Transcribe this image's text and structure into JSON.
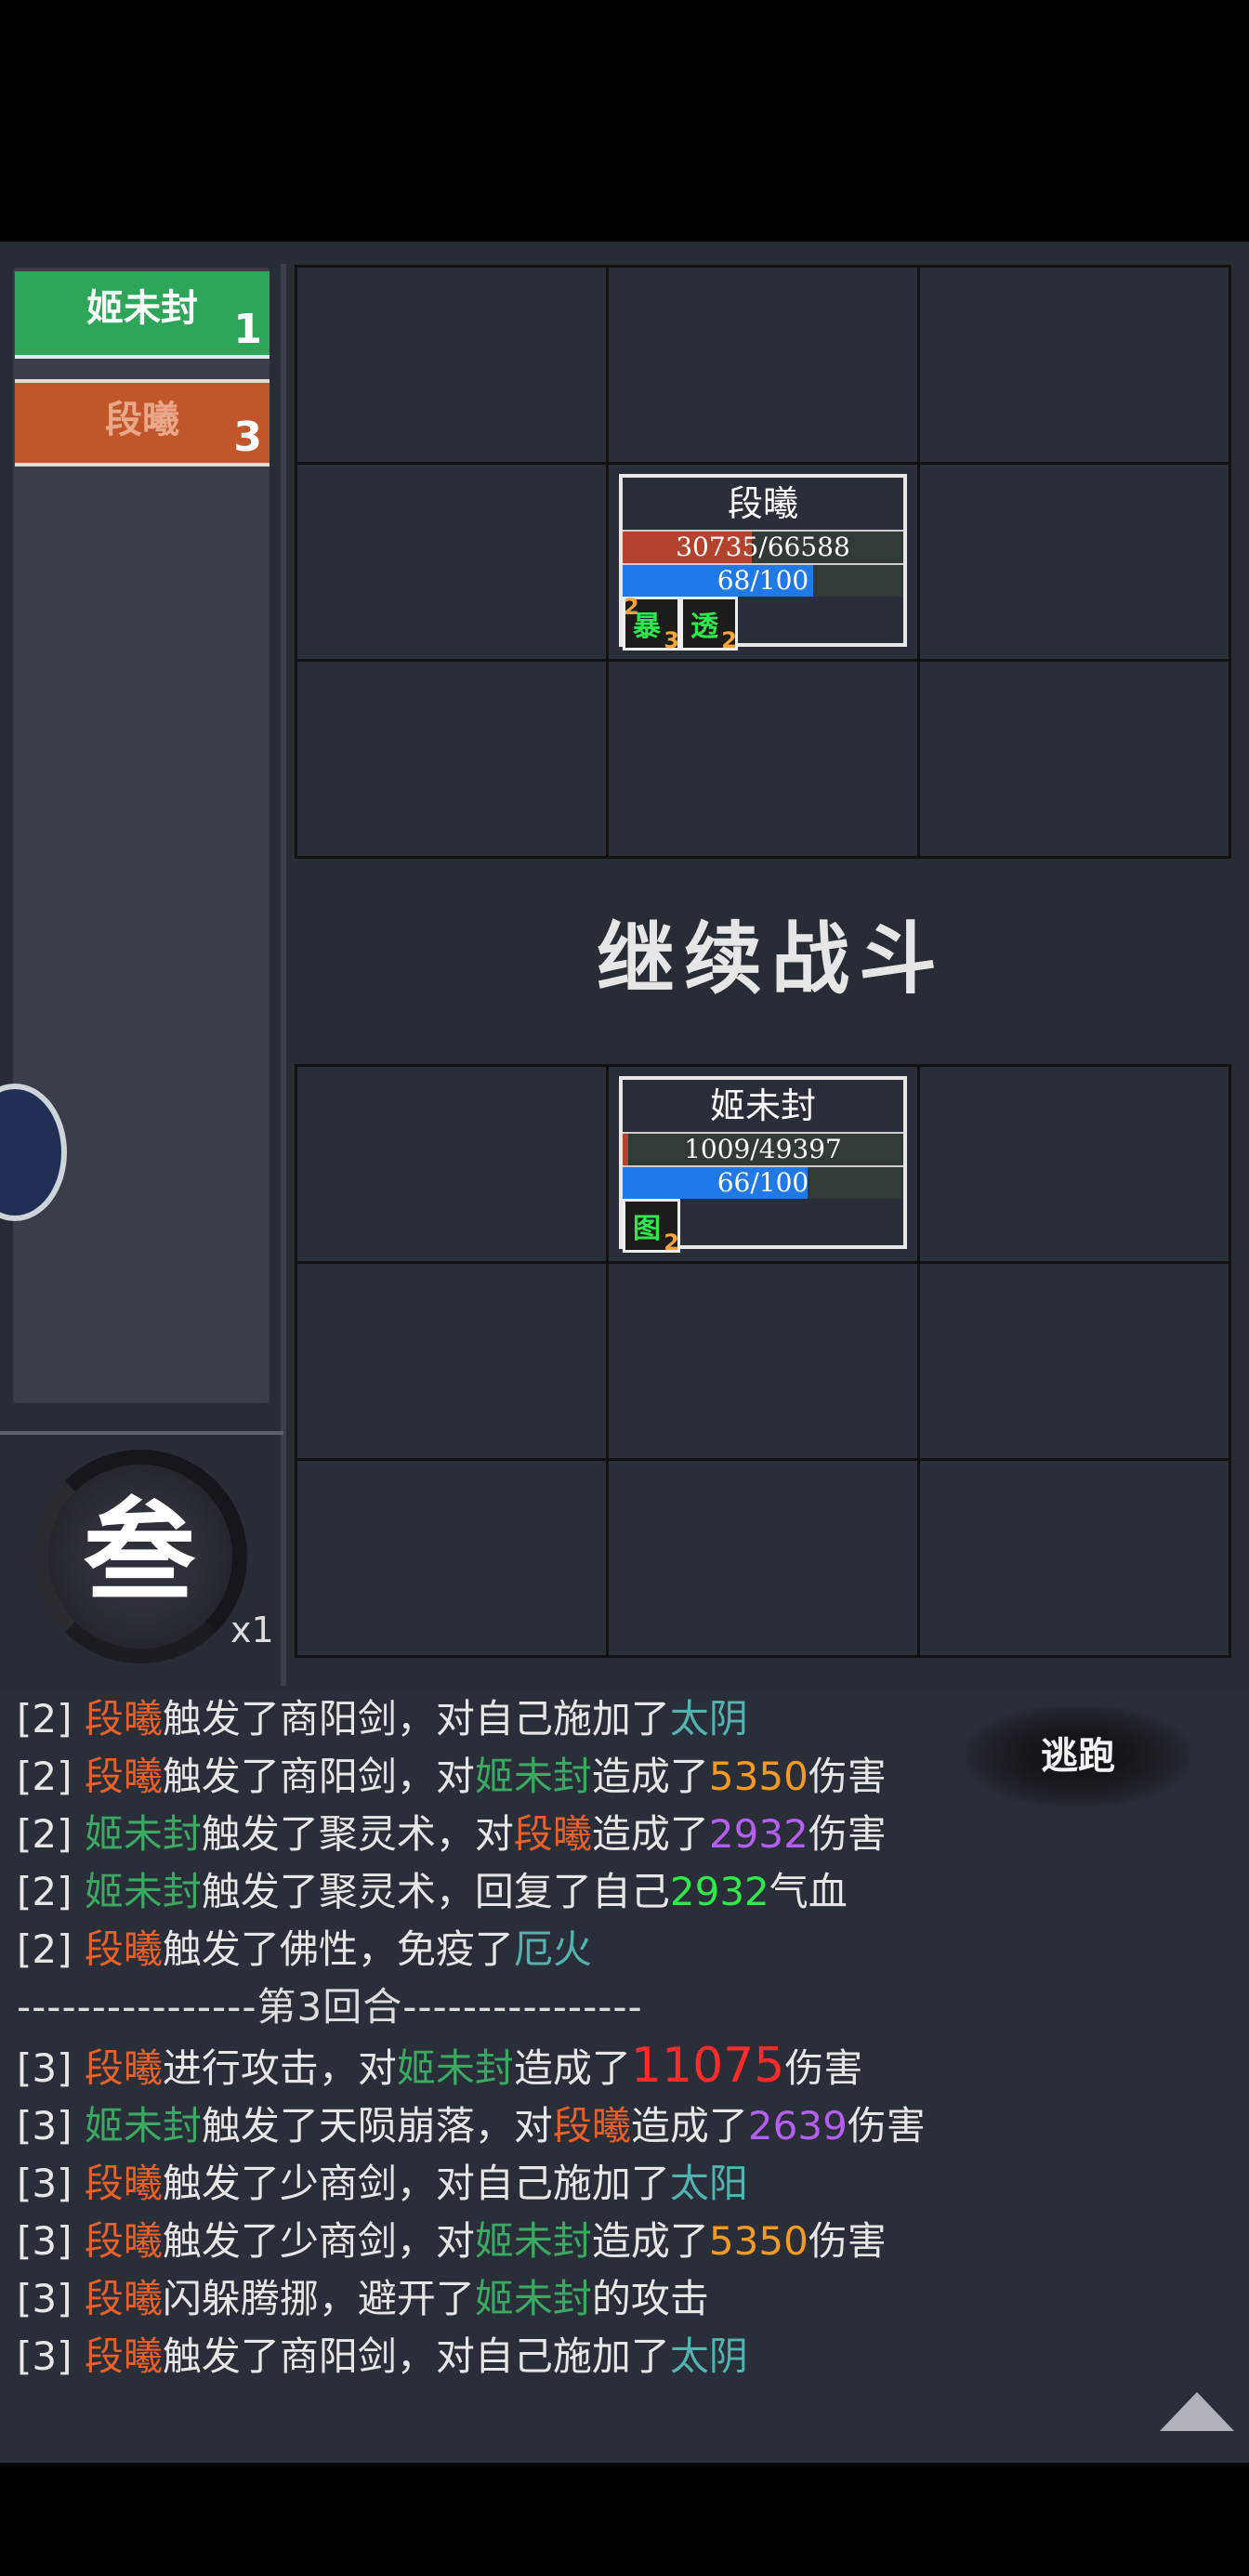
{
  "team_list": [
    {
      "name": "姬未封",
      "count": "1"
    },
    {
      "name": "段曦",
      "count": "3"
    }
  ],
  "enemy_unit": {
    "name": "段曦",
    "hp_text": "30735/66588",
    "hp_fraction": 0.46,
    "mp_text": "68/100",
    "mp_fraction": 0.68,
    "buffs": [
      {
        "glyph": "暴",
        "stack_left": "2",
        "stack_right": "3"
      },
      {
        "glyph": "透",
        "stack_right": "2"
      }
    ]
  },
  "ally_unit": {
    "name": "姬未封",
    "hp_text": "1009/49397",
    "hp_fraction": 0.02,
    "mp_text": "66/100",
    "mp_fraction": 0.66,
    "buffs": [
      {
        "glyph": "图",
        "stack_right": "2"
      }
    ]
  },
  "continue_label": "继续战斗",
  "round_char": "叁",
  "speed_label": "x1",
  "flee_label": "逃跑",
  "log": [
    [
      [
        "[2] ",
        ""
      ],
      [
        "段曦",
        "enemy"
      ],
      [
        "触发了商阳剑，对自己施加了",
        ""
      ],
      [
        "太阴",
        "teal"
      ]
    ],
    [
      [
        "[2] ",
        ""
      ],
      [
        "段曦",
        "enemy"
      ],
      [
        "触发了商阳剑，对",
        ""
      ],
      [
        "姬未封",
        "ally"
      ],
      [
        "造成了",
        ""
      ],
      [
        "5350",
        "orange"
      ],
      [
        "伤害",
        ""
      ]
    ],
    [
      [
        "[2] ",
        ""
      ],
      [
        "姬未封",
        "ally"
      ],
      [
        "触发了聚灵术，对",
        ""
      ],
      [
        "段曦",
        "enemy"
      ],
      [
        "造成了",
        ""
      ],
      [
        "2932",
        "purple"
      ],
      [
        "伤害",
        ""
      ]
    ],
    [
      [
        "[2] ",
        ""
      ],
      [
        "姬未封",
        "ally"
      ],
      [
        "触发了聚灵术，回复了自己",
        ""
      ],
      [
        "2932",
        "green"
      ],
      [
        "气血",
        ""
      ]
    ],
    [
      [
        "[2] ",
        ""
      ],
      [
        "段曦",
        "enemy"
      ],
      [
        "触发了佛性，免疫了",
        ""
      ],
      [
        "厄火",
        "teal"
      ]
    ],
    [
      [
        "----------------第3回合----------------",
        "sep"
      ]
    ],
    [
      [
        "[3] ",
        ""
      ],
      [
        "段曦",
        "enemy"
      ],
      [
        "进行攻击，对",
        ""
      ],
      [
        "姬未封",
        "ally"
      ],
      [
        "造成了",
        ""
      ],
      [
        "11075",
        "red"
      ],
      [
        "伤害",
        ""
      ]
    ],
    [
      [
        "[3] ",
        ""
      ],
      [
        "姬未封",
        "ally"
      ],
      [
        "触发了天陨崩落，对",
        ""
      ],
      [
        "段曦",
        "enemy"
      ],
      [
        "造成了",
        ""
      ],
      [
        "2639",
        "purple"
      ],
      [
        "伤害",
        ""
      ]
    ],
    [
      [
        "[3] ",
        ""
      ],
      [
        "段曦",
        "enemy"
      ],
      [
        "触发了少商剑，对自己施加了",
        ""
      ],
      [
        "太阳",
        "teal"
      ]
    ],
    [
      [
        "[3] ",
        ""
      ],
      [
        "段曦",
        "enemy"
      ],
      [
        "触发了少商剑，对",
        ""
      ],
      [
        "姬未封",
        "ally"
      ],
      [
        "造成了",
        ""
      ],
      [
        "5350",
        "orange"
      ],
      [
        "伤害",
        ""
      ]
    ],
    [
      [
        "[3] ",
        ""
      ],
      [
        "段曦",
        "enemy"
      ],
      [
        "闪躲腾挪，避开了",
        ""
      ],
      [
        "姬未封",
        "ally"
      ],
      [
        "的攻击",
        ""
      ]
    ],
    [
      [
        "[3] ",
        ""
      ],
      [
        "段曦",
        "enemy"
      ],
      [
        "触发了商阳剑，对自己施加了",
        ""
      ],
      [
        "太阴",
        "teal"
      ]
    ]
  ],
  "icons": {
    "scroll_top": "triangle-up-icon",
    "side_knob": "portrait-knob-icon"
  }
}
